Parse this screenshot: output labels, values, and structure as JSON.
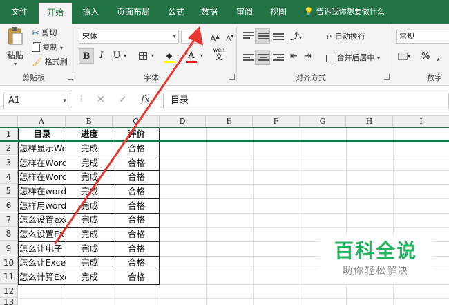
{
  "tabs": [
    {
      "label": "文件",
      "active": false
    },
    {
      "label": "开始",
      "active": true
    },
    {
      "label": "插入",
      "active": false
    },
    {
      "label": "页面布局",
      "active": false
    },
    {
      "label": "公式",
      "active": false
    },
    {
      "label": "数据",
      "active": false
    },
    {
      "label": "审阅",
      "active": false
    },
    {
      "label": "视图",
      "active": false
    }
  ],
  "tell_me": "告诉我你想要做什么",
  "ribbon": {
    "clipboard": {
      "paste": "粘贴",
      "cut": "剪切",
      "copy": "复制",
      "format_painter": "格式刷",
      "group_label": "剪贴板"
    },
    "font": {
      "font_name": "宋体",
      "bold": "B",
      "italic": "I",
      "underline": "U",
      "grow": "A",
      "shrink": "A",
      "font_color_letter": "A",
      "wen": "wén",
      "group_label": "字体"
    },
    "alignment": {
      "wrap_text": "自动换行",
      "merge_center": "合并后居中",
      "group_label": "对齐方式"
    },
    "number": {
      "format": "常规",
      "percent": "%",
      "comma": ",",
      "group_label": "数字"
    }
  },
  "formula_bar": {
    "name_box": "A1",
    "cancel": "✕",
    "enter": "✓",
    "fx": "fx",
    "content": "目录"
  },
  "columns": [
    "A",
    "B",
    "C",
    "D",
    "E",
    "F",
    "G",
    "H",
    "I"
  ],
  "rows": [
    "1",
    "2",
    "3",
    "4",
    "5",
    "6",
    "7",
    "8",
    "9",
    "10",
    "11",
    "12",
    "13"
  ],
  "table": {
    "headers": [
      "目录",
      "进度",
      "评价"
    ],
    "rows": [
      [
        "怎样显示Wo",
        "完成",
        "合格"
      ],
      [
        "怎样在Word",
        "完成",
        "合格"
      ],
      [
        "怎样在Word",
        "完成",
        "合格"
      ],
      [
        "怎样在word",
        "完成",
        "合格"
      ],
      [
        "怎样用word",
        "完成",
        "合格"
      ],
      [
        "怎么设置exc",
        "完成",
        "合格"
      ],
      [
        "怎么设置Ex",
        "完成",
        "合格"
      ],
      [
        "怎么让电子",
        "完成",
        "合格"
      ],
      [
        "怎么让Excel",
        "完成",
        "合格"
      ],
      [
        "怎么计算Exc",
        "完成",
        "合格"
      ]
    ]
  },
  "watermark": {
    "title": "百科全说",
    "subtitle": "助你轻松解决"
  },
  "colors": {
    "accent": "#217346",
    "arrow": "#e8352e",
    "watermark": "#22b35e"
  }
}
